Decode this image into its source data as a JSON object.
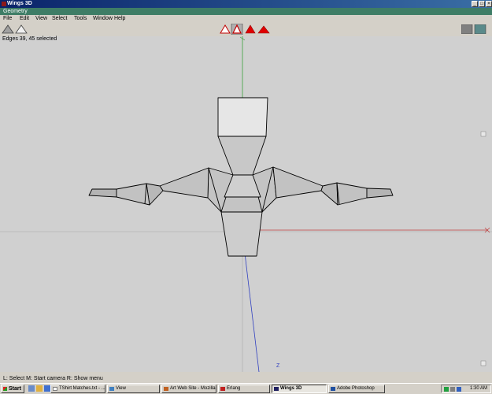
{
  "window": {
    "title": "Wings 3D",
    "minimize": "_",
    "maximize": "□",
    "close": "×"
  },
  "geometry_bar": {
    "label": "Geometry"
  },
  "menubar": {
    "items": [
      "File",
      "Edit",
      "View",
      "Select",
      "Tools",
      "Window",
      "Help"
    ]
  },
  "viewport": {
    "status": "Edges 39, 45 selected",
    "axis_label_z": "Z"
  },
  "infoline": {
    "text": "L: Select  M: Start camera  R: Show menu"
  },
  "taskbar": {
    "start": "Start",
    "tasks": [
      {
        "label": "TShirt Matches.txt - ...",
        "active": false
      },
      {
        "label": "View",
        "active": false
      },
      {
        "label": "Art Web Site - Mozilla",
        "active": false
      },
      {
        "label": "Erlang",
        "active": false
      },
      {
        "label": "Wings 3D",
        "active": true
      },
      {
        "label": "Adobe Photoshop",
        "active": false
      }
    ],
    "clock": "1:30 AM"
  },
  "colors": {
    "title_bar": "#0a246a",
    "geometry_bar": "#3e7d66",
    "x_axis": "#c04040",
    "y_axis": "#40a040",
    "z_axis": "#4040c0",
    "selection_red": "#e00000"
  }
}
